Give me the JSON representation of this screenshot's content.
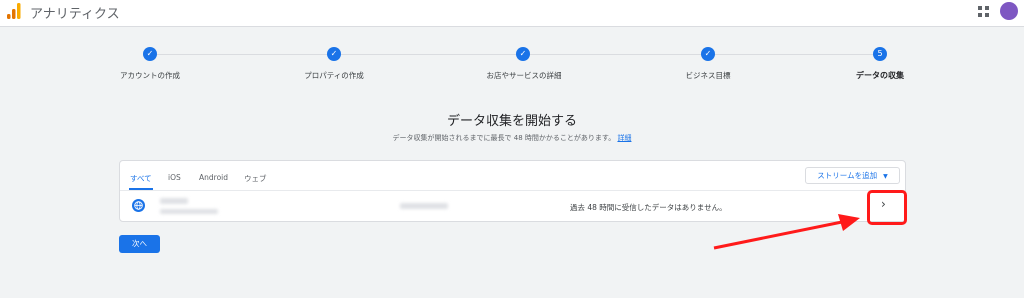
{
  "header": {
    "app_title": "アナリティクス"
  },
  "stepper": {
    "steps": [
      {
        "label": "アカウントの作成",
        "state": "done",
        "icon": "check-icon"
      },
      {
        "label": "プロパティの作成",
        "state": "done",
        "icon": "check-icon"
      },
      {
        "label": "お店やサービスの詳細",
        "state": "done",
        "icon": "check-icon"
      },
      {
        "label": "ビジネス目標",
        "state": "done",
        "icon": "check-icon"
      },
      {
        "label": "データの収集",
        "state": "active",
        "number": "5"
      }
    ]
  },
  "main": {
    "title": "データ収集を開始する",
    "subtitle": "データ収集が開始されるまでに最長で 48 時間かかることがあります。",
    "details_link": "詳細"
  },
  "streams": {
    "tabs": [
      "すべて",
      "iOS",
      "Android",
      "ウェブ"
    ],
    "add_stream_label": "ストリームを追加",
    "rows": [
      {
        "icon": "globe-icon",
        "status": "過去 48 時間に受信したデータはありません。"
      }
    ]
  },
  "footer": {
    "next_label": "次へ"
  },
  "colors": {
    "accent": "#1a73e8",
    "highlight": "#ff1a1a",
    "avatar": "#7e57c2"
  }
}
